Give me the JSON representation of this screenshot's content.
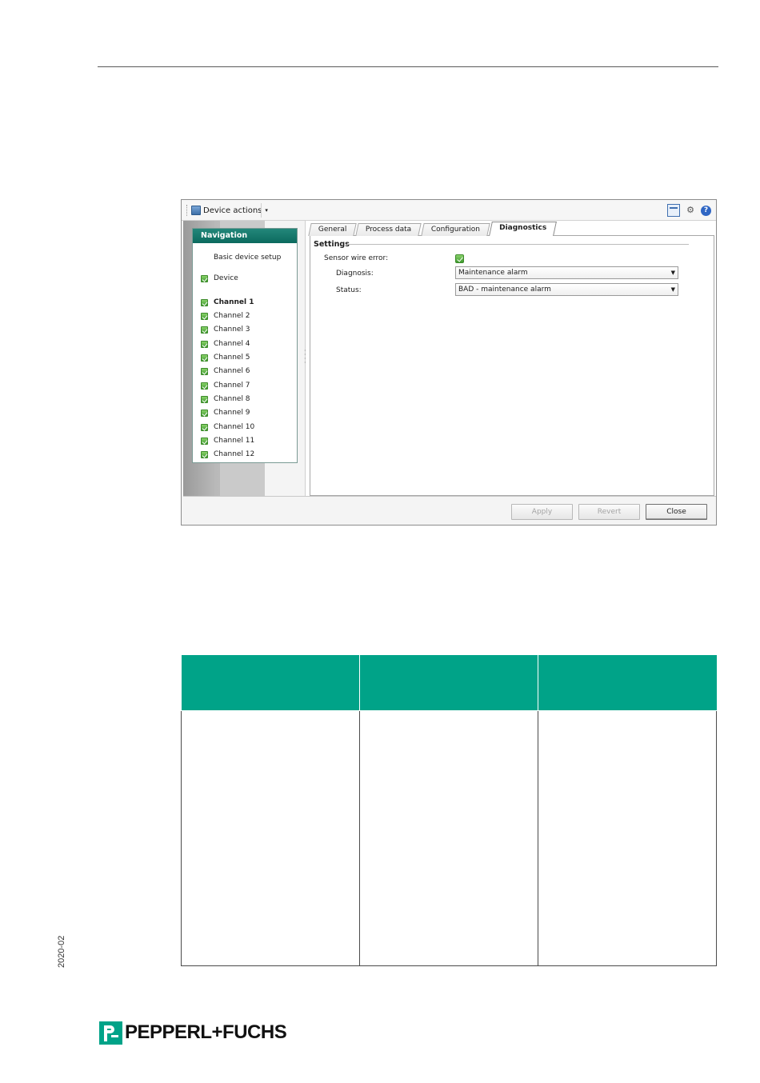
{
  "toolbar": {
    "device_actions": "Device actions",
    "caret": "▾",
    "help": "?"
  },
  "navigation": {
    "title": "Navigation",
    "items": [
      {
        "label": "Basic device setup",
        "check": false,
        "bold": false
      },
      {
        "label": "Device",
        "check": true,
        "bold": false
      },
      {
        "label": "Channel 1",
        "check": true,
        "bold": true
      },
      {
        "label": "Channel 2",
        "check": true,
        "bold": false
      },
      {
        "label": "Channel 3",
        "check": true,
        "bold": false
      },
      {
        "label": "Channel 4",
        "check": true,
        "bold": false
      },
      {
        "label": "Channel 5",
        "check": true,
        "bold": false
      },
      {
        "label": "Channel 6",
        "check": true,
        "bold": false
      },
      {
        "label": "Channel 7",
        "check": true,
        "bold": false
      },
      {
        "label": "Channel 8",
        "check": true,
        "bold": false
      },
      {
        "label": "Channel 9",
        "check": true,
        "bold": false
      },
      {
        "label": "Channel 10",
        "check": true,
        "bold": false
      },
      {
        "label": "Channel 11",
        "check": true,
        "bold": false
      },
      {
        "label": "Channel 12",
        "check": true,
        "bold": false
      }
    ]
  },
  "tabs": [
    {
      "label": "General",
      "active": false
    },
    {
      "label": "Process data",
      "active": false
    },
    {
      "label": "Configuration",
      "active": false
    },
    {
      "label": "Diagnostics",
      "active": true
    }
  ],
  "settings": {
    "title": "Settings",
    "sensor_wire_error_label": "Sensor wire error:",
    "sensor_wire_error_checked": true,
    "diagnosis_label": "Diagnosis:",
    "diagnosis_value": "Maintenance alarm",
    "status_label": "Status:",
    "status_value": "BAD - maintenance alarm"
  },
  "buttons": {
    "apply": "Apply",
    "revert": "Revert",
    "close": "Close"
  },
  "side_date": "2020-02",
  "logo_text": "PEPPERL+FUCHS",
  "colors": {
    "brand_green": "#00a388",
    "nav_header": "#0b6a5e"
  }
}
